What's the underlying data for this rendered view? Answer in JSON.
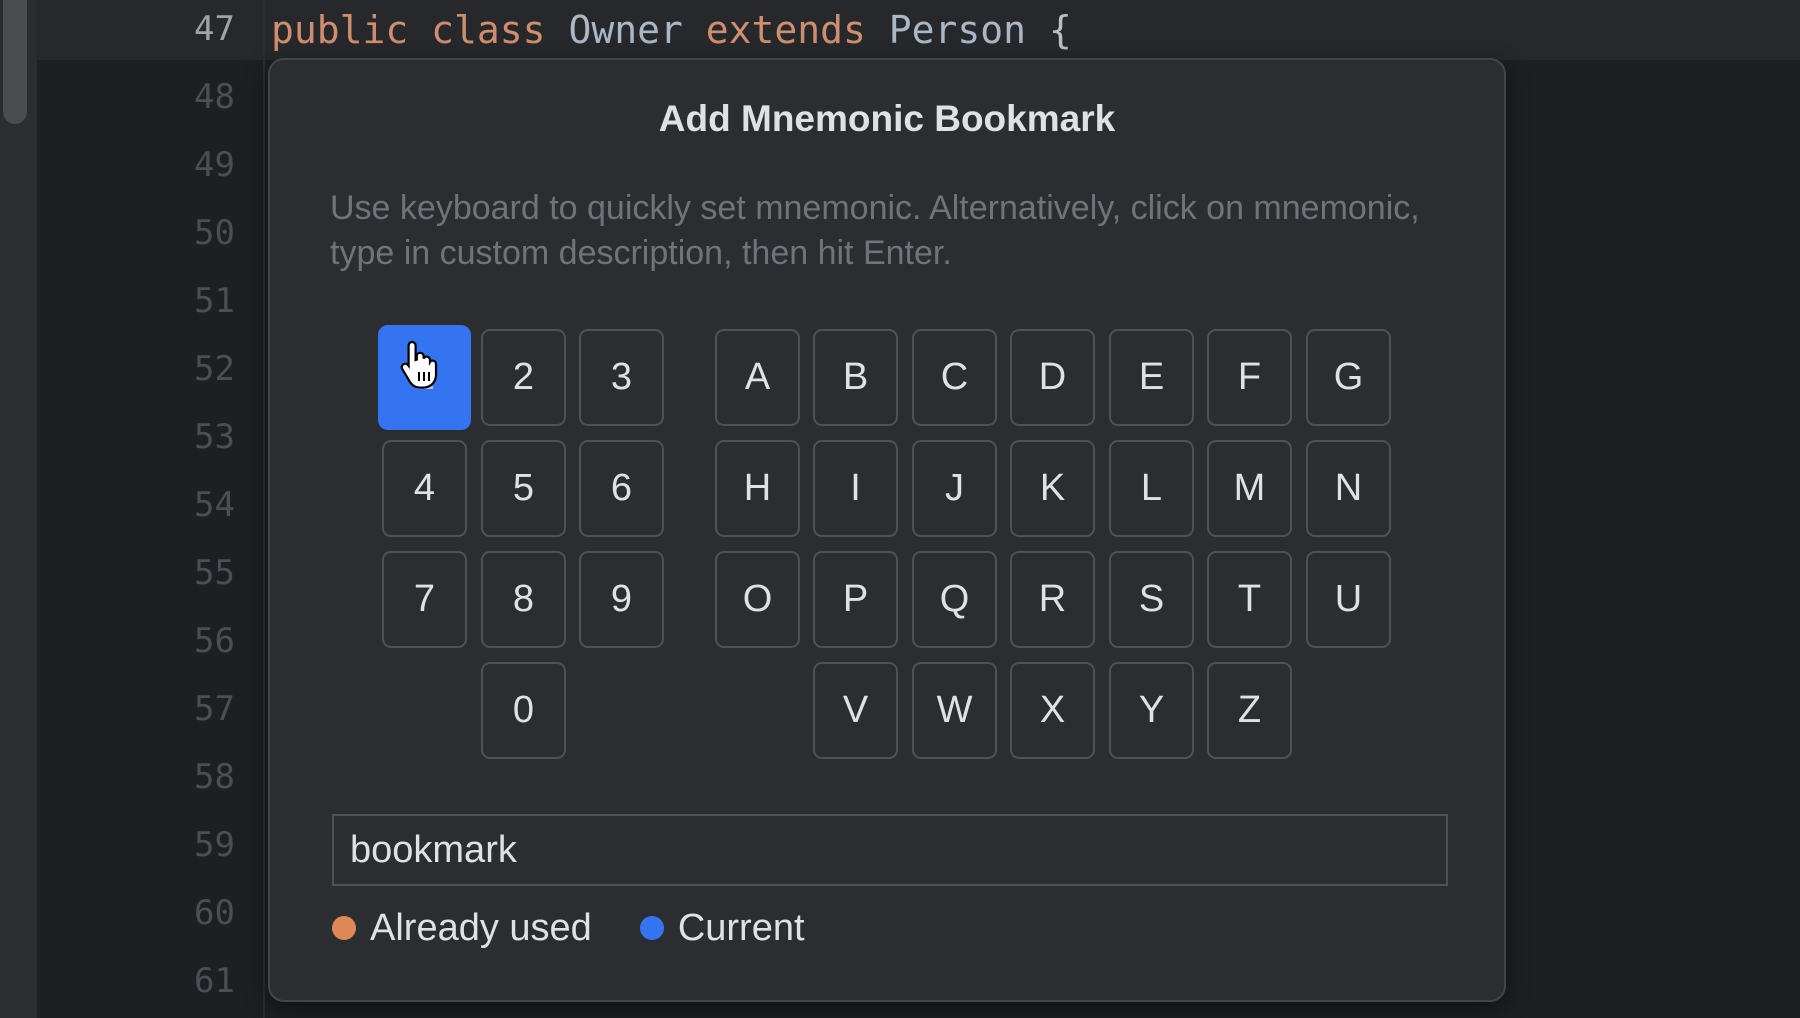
{
  "editor": {
    "current_line": "47",
    "line_numbers": [
      "47",
      "48",
      "49",
      "50",
      "51",
      "52",
      "53",
      "54",
      "55",
      "56",
      "57",
      "58",
      "59",
      "60",
      "61"
    ],
    "code_line": {
      "tokens": [
        {
          "text": "public",
          "type": "keyword"
        },
        {
          "text": " ",
          "type": "space"
        },
        {
          "text": "class",
          "type": "keyword"
        },
        {
          "text": " ",
          "type": "space"
        },
        {
          "text": "Owner",
          "type": "identifier"
        },
        {
          "text": " ",
          "type": "space"
        },
        {
          "text": "extends",
          "type": "keyword"
        },
        {
          "text": " ",
          "type": "space"
        },
        {
          "text": "Person",
          "type": "identifier"
        },
        {
          "text": " {",
          "type": "plain"
        }
      ]
    }
  },
  "popup": {
    "title": "Add Mnemonic Bookmark",
    "description": "Use keyboard to quickly set mnemonic. Alternatively, click on mnemonic, type in custom description, then hit Enter.",
    "current_key": "1",
    "digit_rows": [
      [
        "1",
        "2",
        "3"
      ],
      [
        "4",
        "5",
        "6"
      ],
      [
        "7",
        "8",
        "9"
      ],
      [
        "",
        "0",
        ""
      ]
    ],
    "letter_rows": [
      [
        "A",
        "B",
        "C",
        "D",
        "E",
        "F",
        "G"
      ],
      [
        "H",
        "I",
        "J",
        "K",
        "L",
        "M",
        "N"
      ],
      [
        "O",
        "P",
        "Q",
        "R",
        "S",
        "T",
        "U"
      ],
      [
        "",
        "V",
        "W",
        "X",
        "Y",
        "Z",
        ""
      ]
    ],
    "input_value": "bookmark",
    "legend": [
      {
        "label": "Already used",
        "color": "#e08855"
      },
      {
        "label": "Current",
        "color": "#3574f0"
      }
    ]
  }
}
